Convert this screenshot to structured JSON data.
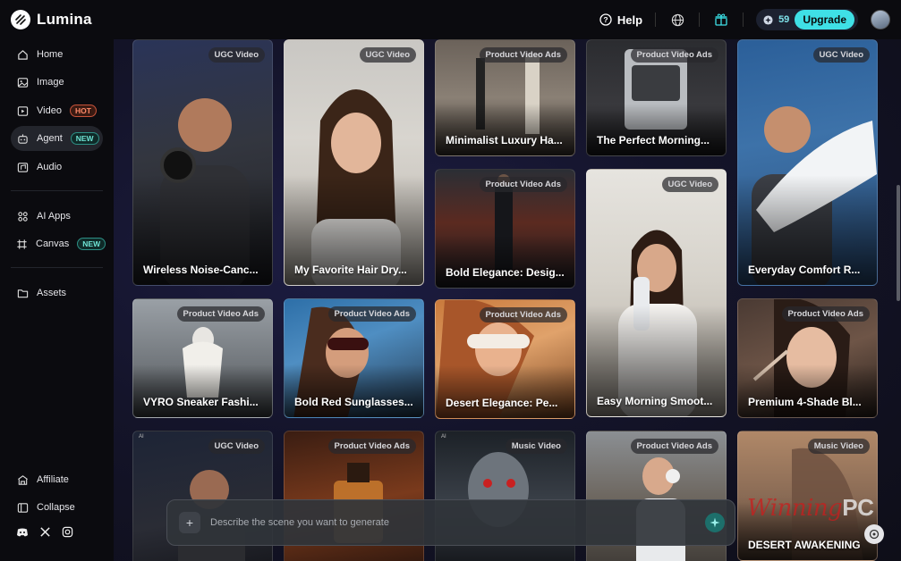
{
  "brand": {
    "name": "Lumina"
  },
  "topbar": {
    "help_label": "Help",
    "credits": "59",
    "upgrade_label": "Upgrade"
  },
  "sidebar": {
    "items": [
      {
        "label": "Home"
      },
      {
        "label": "Image"
      },
      {
        "label": "Video",
        "badge": "HOT"
      },
      {
        "label": "Agent",
        "badge": "NEW"
      },
      {
        "label": "Audio"
      },
      {
        "label": "AI Apps"
      },
      {
        "label": "Canvas",
        "badge": "NEW"
      },
      {
        "label": "Assets"
      }
    ],
    "footer": [
      {
        "label": "Affiliate"
      },
      {
        "label": "Collapse"
      }
    ]
  },
  "cards": [
    {
      "tag": "UGC Video",
      "title": "Wireless Noise-Canc..."
    },
    {
      "tag": "UGC Video",
      "title": "My Favorite Hair Dry..."
    },
    {
      "tag": "Product Video Ads",
      "title": "Minimalist Luxury Ha..."
    },
    {
      "tag": "Product Video Ads",
      "title": "The Perfect Morning..."
    },
    {
      "tag": "UGC Video",
      "title": "Everyday Comfort R..."
    },
    {
      "tag": "Product Video Ads",
      "title": "Bold Elegance: Desig..."
    },
    {
      "tag": "UGC Video",
      "title": "Easy Morning Smoot..."
    },
    {
      "tag": "Product Video Ads",
      "title": "VYRO Sneaker Fashi..."
    },
    {
      "tag": "Product Video Ads",
      "title": "Bold Red Sunglasses..."
    },
    {
      "tag": "Product Video Ads",
      "title": "Desert Elegance: Pe..."
    },
    {
      "tag": "Product Video Ads",
      "title": "Premium 4-Shade Bl..."
    },
    {
      "tag": "UGC Video",
      "title": ""
    },
    {
      "tag": "Product Video Ads",
      "title": ""
    },
    {
      "tag": "Music Video",
      "title": ""
    },
    {
      "tag": "Product Video Ads",
      "title": ""
    },
    {
      "tag": "Music Video",
      "title": "DESERT AWAKENING"
    }
  ],
  "prompt": {
    "placeholder": "Describe the scene you want to generate"
  },
  "watermark": {
    "text": "Winning",
    "suffix": "PC"
  },
  "colors": {
    "accent": "#3fe0e6",
    "hot": "#ff8a6a",
    "new": "#6fe3d4"
  }
}
